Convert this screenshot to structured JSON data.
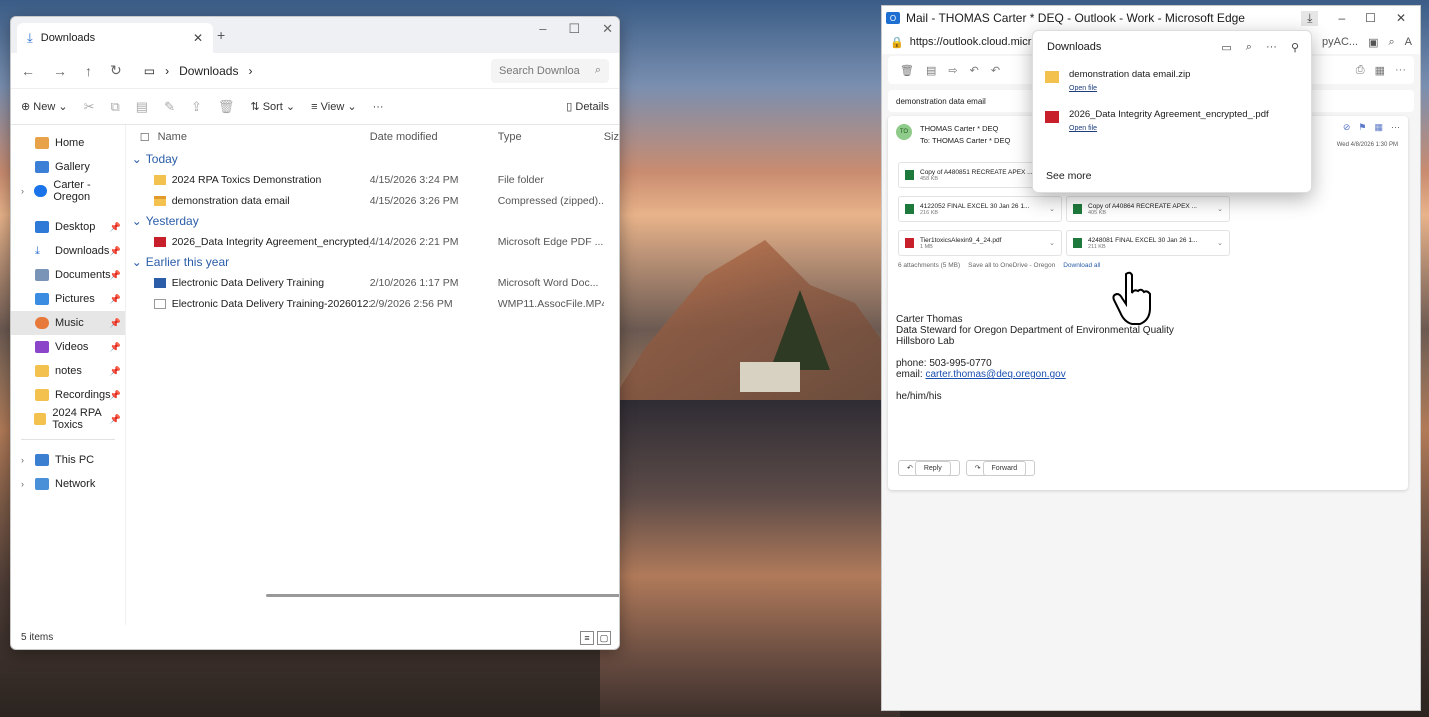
{
  "explorer": {
    "tab_label": "Downloads",
    "newtab": "+",
    "address_crumb": "Downloads",
    "search_placeholder": "Search Downloa",
    "toolbar": {
      "new": "New",
      "sort": "Sort",
      "view": "View",
      "details": "Details"
    },
    "columns": {
      "name": "Name",
      "date": "Date modified",
      "type": "Type",
      "size": "Siz"
    },
    "nav": {
      "home": "Home",
      "gallery": "Gallery",
      "carter": "Carter - Oregon",
      "desktop": "Desktop",
      "downloads": "Downloads",
      "documents": "Documents",
      "pictures": "Pictures",
      "music": "Music",
      "videos": "Videos",
      "notes": "notes",
      "recordings": "Recordings",
      "rpa": "2024 RPA Toxics",
      "thispc": "This PC",
      "network": "Network"
    },
    "groups": {
      "today": "Today",
      "yesterday": "Yesterday",
      "earlier": "Earlier this year"
    },
    "files": [
      {
        "name": "2024 RPA Toxics Demonstration",
        "date": "4/15/2026 3:24 PM",
        "type": "File folder"
      },
      {
        "name": "demonstration data email",
        "date": "4/15/2026 3:26 PM",
        "type": "Compressed (zipped)..."
      },
      {
        "name": "2026_Data Integrity Agreement_encrypted_",
        "date": "4/14/2026 2:21 PM",
        "type": "Microsoft Edge PDF ..."
      },
      {
        "name": "Electronic Data Delivery Training",
        "date": "2/10/2026 1:17 PM",
        "type": "Microsoft Word Doc..."
      },
      {
        "name": "Electronic Data Delivery Training-20260121_1...",
        "date": "2/9/2026 2:56 PM",
        "type": "WMP11.AssocFile.MP4"
      }
    ],
    "status": "5 items"
  },
  "edge": {
    "title": "Mail - THOMAS Carter * DEQ - Outlook - Work - Microsoft Edge",
    "url": "https://outlook.cloud.micr",
    "url_right": "pyAC...",
    "subject": "demonstration data email",
    "sender_name": "THOMAS Carter * DEQ",
    "sender_initials": "TO",
    "to_line": "To: THOMAS Carter * DEQ",
    "date": "Wed 4/8/2026 1:30 PM",
    "attachments": [
      {
        "name": "Copy of A480851 RECREATE APEX ...",
        "size": "458 KB"
      },
      {
        "name": "4122052 FINAL EXCEL 30 Jan 26 1...",
        "size": "216 KB"
      },
      {
        "name": "Copy of A40864 RECREATE APEX ...",
        "size": "405 KB"
      },
      {
        "name": "Tier1toxicsAlexin9_4_24.pdf",
        "size": "1 MB"
      },
      {
        "name": "4248081 FINAL EXCEL 30 Jan 26 1...",
        "size": "211 KB"
      }
    ],
    "attach_count": "6 attachments (5 MB)",
    "save_onedrive": "Save all to OneDrive - Oregon",
    "download_all": "Download all",
    "signature": {
      "name": "Carter Thomas",
      "title": "Data Steward for Oregon Department of Environmental Quality",
      "lab": "Hillsboro Lab",
      "phone": "phone: 503-995-0770",
      "email_label": "email:",
      "email": "carter.thomas@deq.oregon.gov",
      "pronouns": "he/him/his"
    },
    "reply": "Reply",
    "forward": "Forward"
  },
  "downloads_flyout": {
    "title": "Downloads",
    "items": [
      {
        "name": "demonstration data email.zip",
        "action": "Open file"
      },
      {
        "name": "2026_Data Integrity Agreement_encrypted_.pdf",
        "action": "Open file"
      }
    ],
    "see_more": "See more"
  }
}
